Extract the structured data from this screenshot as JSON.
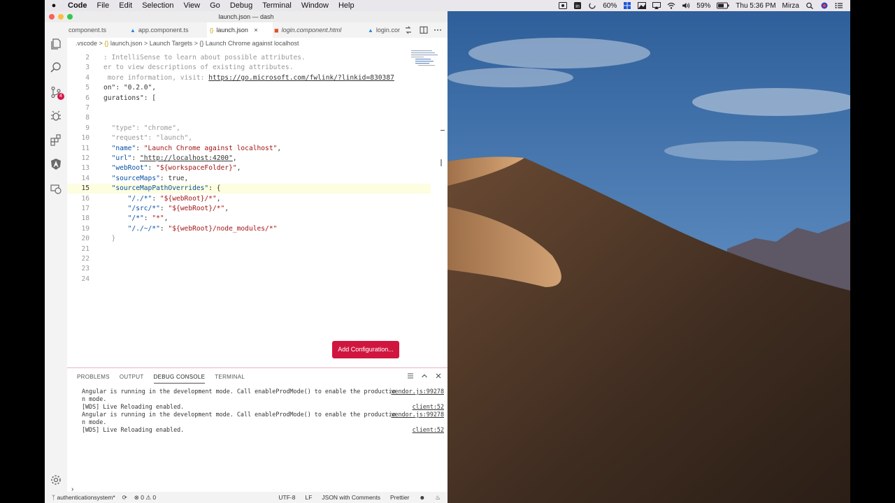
{
  "menubar": {
    "apple": "",
    "items": [
      "Code",
      "File",
      "Edit",
      "Selection",
      "View",
      "Go",
      "Debug",
      "Terminal",
      "Window",
      "Help"
    ],
    "status": {
      "battery_small": "60%",
      "battery": "59%",
      "clock": "Thu 5:36 PM",
      "user": "Mirza"
    }
  },
  "window": {
    "title": "launch.json — dash"
  },
  "tabs": [
    {
      "label": "component.ts",
      "icon": "ts-file-icon"
    },
    {
      "label": "app.component.ts",
      "icon": "angular-icon"
    },
    {
      "label": "launch.json",
      "icon": "json-braces-icon",
      "close": "×"
    },
    {
      "label": "login.component.html",
      "icon": "html5-icon"
    },
    {
      "label": "login.cor",
      "icon": "angular-icon"
    }
  ],
  "breadcrumbs": [
    ".vscode",
    "launch.json",
    "Launch Targets",
    "Launch Chrome against localhost"
  ],
  "breadcrumb_sep": ">",
  "breadcrumb_braces": "{}",
  "editor": {
    "current_line": 15,
    "lines": [
      {
        "n": "2",
        "t": ": IntelliSense to learn about possible attributes."
      },
      {
        "n": "3",
        "t": "er to view descriptions of existing attributes."
      },
      {
        "n": "4",
        "t": " more information, visit: ",
        "url": "https://go.microsoft.com/fwlink/?linkid=830387"
      },
      {
        "n": "5",
        "t": "on\": \"0.2.0\","
      },
      {
        "n": "6",
        "t": "gurations\": ["
      },
      {
        "n": "7",
        "t": ""
      },
      {
        "n": "8",
        "t": ""
      },
      {
        "n": "9",
        "t": "  \"type\": \"chrome\","
      },
      {
        "n": "10",
        "t": "  \"request\": \"launch\","
      },
      {
        "n": "11",
        "key": "\"name\"",
        "val": "\"Launch Chrome against localhost\"",
        "end": ","
      },
      {
        "n": "12",
        "key": "\"url\"",
        "val": "\"http://localhost:4200\"",
        "end": ","
      },
      {
        "n": "13",
        "key": "\"webRoot\"",
        "val": "\"${workspaceFolder}\"",
        "end": ","
      },
      {
        "n": "14",
        "key": "\"sourceMaps\"",
        "val": "true",
        "end": ","
      },
      {
        "n": "15",
        "key": "\"sourceMapPathOverrides\"",
        "val": "{",
        "end": ""
      },
      {
        "n": "16",
        "key": "\"/./*\"",
        "val": "\"${webRoot}/*\"",
        "end": ",",
        "indent": 2
      },
      {
        "n": "17",
        "key": "\"/src/*\"",
        "val": "\"${webRoot}/*\"",
        "end": ",",
        "indent": 2
      },
      {
        "n": "18",
        "key": "\"/*\"",
        "val": "\"*\"",
        "end": ",",
        "indent": 2
      },
      {
        "n": "19",
        "key": "\"/./~/*\"",
        "val": "\"${webRoot}/node_modules/*\"",
        "end": "",
        "indent": 2
      },
      {
        "n": "20",
        "t": "  }"
      },
      {
        "n": "21",
        "t": ""
      },
      {
        "n": "22",
        "t": ""
      },
      {
        "n": "23",
        "t": ""
      },
      {
        "n": "24",
        "t": ""
      }
    ],
    "add_configuration_label": "Add Configuration..."
  },
  "panel": {
    "tabs": [
      "PROBLEMS",
      "OUTPUT",
      "DEBUG CONSOLE",
      "TERMINAL"
    ],
    "active_tab": "DEBUG CONSOLE",
    "lines": [
      {
        "text": "Angular is running in the development mode. Call enableProdMode() to enable the productio",
        "src": "vendor.js:99278"
      },
      {
        "text": "n mode.",
        "src": ""
      },
      {
        "text": "[WDS] Live Reloading enabled.",
        "src": "client:52"
      },
      {
        "text": "Angular is running in the development mode. Call enableProdMode() to enable the productio",
        "src": "vendor.js:99278"
      },
      {
        "text": "n mode.",
        "src": ""
      },
      {
        "text": "[WDS] Live Reloading enabled.",
        "src": "client:52"
      }
    ],
    "prompt": "›"
  },
  "statusbar": {
    "branch": "authenticationsystem*",
    "errors": "0",
    "warnings": "0",
    "encoding": "UTF-8",
    "eol": "LF",
    "language": "JSON with Comments",
    "formatter": "Prettier"
  },
  "colors": {
    "accent_red": "#d0163f",
    "json_key": "#0451a5",
    "json_string": "#a31515"
  }
}
